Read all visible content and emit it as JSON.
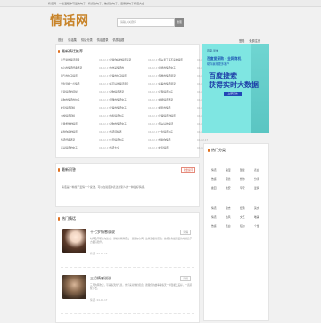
{
  "topbar": {
    "text": "情话网 - 一些温暖你可爱的句子、情感的句子、伤感的句子、语录的句子情话大全"
  },
  "header": {
    "logo": "情话网",
    "search_placeholder": "请输入关键词",
    "search_button": "搜索"
  },
  "nav": {
    "items": [
      "首页",
      "情话集",
      "情话分类",
      "情话语录",
      "情感话题"
    ]
  },
  "header_links": [
    "登陆",
    "免费注册"
  ],
  "hot_section": {
    "title": "最新情话推荐",
    "rows": [
      [
        "关于说的情话语录",
        "04-02-17",
        "说说你好的情话语录",
        "04-02-17",
        "那么爱了喜不完的情话",
        "04-02-17"
      ],
      [
        "会心的情话经典语录",
        "04-02-17",
        "你也是情话的",
        "04-02-17",
        "最终的情话句子",
        "04-02-17"
      ],
      [
        "霸气的句子情话",
        "04-02-17",
        "爱情的句子情话",
        "04-02-17",
        "那样的情话语录",
        "04-02-17"
      ],
      [
        "男生温暖一点情话",
        "04-02-17",
        "好不好的情话语录",
        "04-02-17",
        "好看的情话语录",
        "04-02-17"
      ],
      [
        "爱意情话的问候",
        "04-02-17",
        "对你情话语录",
        "04-02-17",
        "发现情话句子",
        "04-02-17"
      ],
      [
        "后你的情话的句子",
        "04-02-17",
        "更甜的情话句子",
        "04-02-17",
        "暖暖情话语录",
        "04-02-17"
      ],
      [
        "晚安情话问候",
        "04-02-17",
        "爱情的情话句子",
        "04-02-17",
        "相爱的情话",
        "04-02-17"
      ],
      [
        "今晚情话问候",
        "04-02-17",
        "你有情话句子",
        "04-02-17",
        "爱情情话的情话",
        "04-02-17"
      ],
      [
        "让我想你的情话",
        "04-02-17",
        "对你的情话句子",
        "04-02-17",
        "那么好的情话",
        "04-02-17"
      ],
      [
        "看到你真的情话",
        "04-02-17",
        "情话问候语",
        "04-02-17",
        "一生情话句子",
        "04-02-17"
      ],
      [
        "情话经典语录",
        "04-02-17",
        "今天情话句子",
        "04-02-17",
        "想和你情话",
        "04-02-17"
      ],
      [
        "高兴情话的句子",
        "04-02-17",
        "情话大全",
        "04-02-17",
        "晚安情话",
        "04-02-17"
      ]
    ]
  },
  "ad": {
    "brand": "百度·爱学",
    "line1": "百度爱采购 · 全网商机",
    "line2": "助你赢得更多客户",
    "big1": "百度搜索",
    "big2": "获得实时大数据",
    "cta": "立即咨询"
  },
  "categories_panel": {
    "title": "热门分类",
    "group1": [
      "情话",
      "浪漫",
      "甜蜜",
      "表白",
      "伤感",
      "思念",
      "想你",
      "分手",
      "挽回",
      "晚安",
      "早安",
      "爱情"
    ],
    "group2": [
      "情话",
      "励志",
      "经典",
      "英文",
      "情话",
      "古风",
      "文艺",
      "唯美",
      "伤感",
      "表白",
      "短句",
      "个性"
    ]
  },
  "faq": {
    "title": "最新问答",
    "badge": "我要提问",
    "text": "情话是一种属于爱情一个说法，可以在说话中表达对别人的一种最好情感。"
  },
  "hot_list": {
    "title": "热门情话",
    "cards": [
      {
        "title": "十七岁情感说说",
        "more": "详情",
        "desc": "时间会不断走向远方，却总有些情话会一直留在心间。这些温暖的话语，总能在你最需要的时候给予力量与陪伴。",
        "meta": "情话 · 04-02-17"
      },
      {
        "title": "三月情感说说",
        "more": "详情",
        "desc": "三月的风吹过，带来春天的气息，也带来对你的思念。愿我们的故事像春天一样温暖又美好，一直延续下去。",
        "meta": "情话 · 04-02-17"
      }
    ]
  },
  "colors": {
    "accent": "#c8842a",
    "ad_bg": "#7fe6e2",
    "title_marker": "#e0701e"
  }
}
